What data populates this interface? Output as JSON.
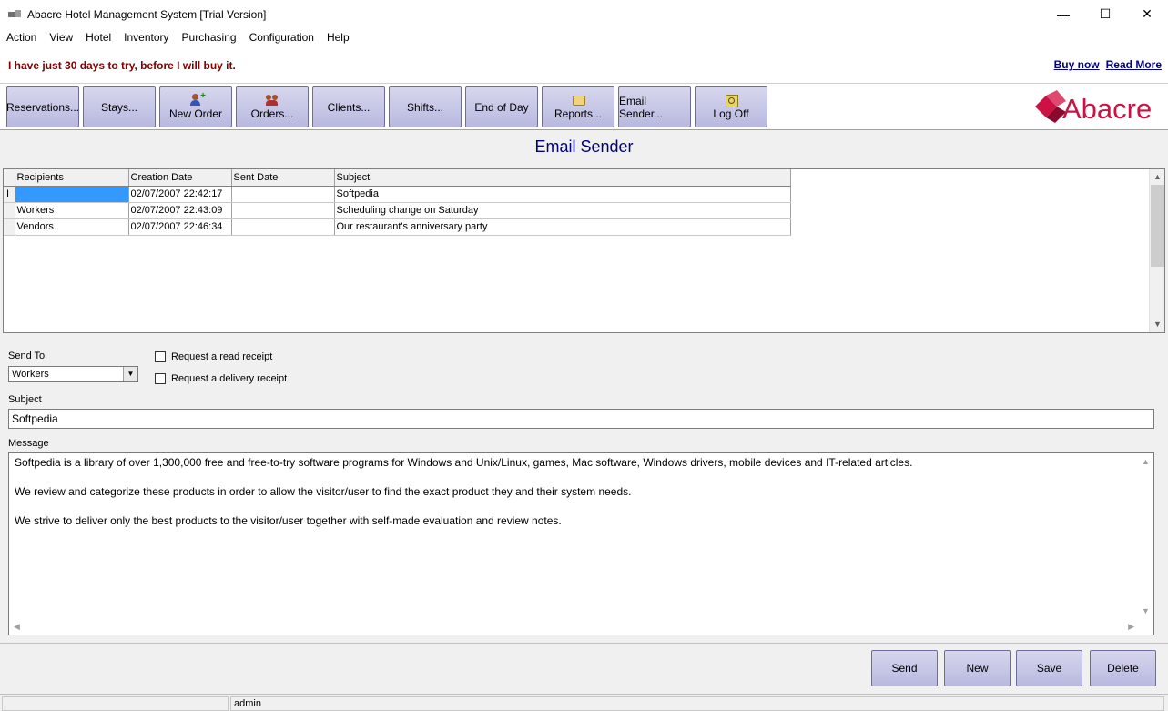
{
  "window": {
    "title": "Abacre Hotel Management System [Trial Version]",
    "controls": {
      "minimize": "—",
      "maximize": "☐",
      "close": "✕"
    }
  },
  "menu": [
    "Action",
    "View",
    "Hotel",
    "Inventory",
    "Purchasing",
    "Configuration",
    "Help"
  ],
  "banner": {
    "trial_text": "I have just 30 days to try, before I will buy it.",
    "buy_now": "Buy now",
    "read_more": "Read More"
  },
  "toolbar": {
    "buttons": [
      {
        "label": "Reservations...",
        "icon": ""
      },
      {
        "label": "Stays...",
        "icon": ""
      },
      {
        "label": "New Order",
        "icon": "new-order-icon"
      },
      {
        "label": "Orders...",
        "icon": "orders-icon"
      },
      {
        "label": "Clients...",
        "icon": ""
      },
      {
        "label": "Shifts...",
        "icon": ""
      },
      {
        "label": "End of Day",
        "icon": ""
      },
      {
        "label": "Reports...",
        "icon": "reports-icon"
      },
      {
        "label": "Email Sender...",
        "icon": ""
      },
      {
        "label": "Log Off",
        "icon": "log-off-icon"
      }
    ],
    "logo_text": "Abacre"
  },
  "page": {
    "title": "Email Sender"
  },
  "grid": {
    "columns": [
      "Recipients",
      "Creation Date",
      "Sent Date",
      "Subject"
    ],
    "rows": [
      {
        "recipients": "",
        "creation_date": "02/07/2007 22:42:17",
        "sent_date": "",
        "subject": "Softpedia"
      },
      {
        "recipients": "Workers",
        "creation_date": "02/07/2007 22:43:09",
        "sent_date": "",
        "subject": "Scheduling change on Saturday"
      },
      {
        "recipients": "Vendors",
        "creation_date": "02/07/2007 22:46:34",
        "sent_date": "",
        "subject": "Our restaurant's anniversary party"
      }
    ]
  },
  "form": {
    "send_to_label": "Send To",
    "send_to_value": "Workers",
    "read_receipt_label": "Request a read receipt",
    "delivery_receipt_label": "Request a delivery receipt",
    "subject_label": "Subject",
    "subject_value": "Softpedia",
    "message_label": "Message",
    "message_lines": [
      "Softpedia is a library of over 1,300,000 free and free-to-try software programs for Windows and Unix/Linux, games, Mac software, Windows drivers, mobile devices and IT-related articles.",
      "We review and categorize these products in order to allow the visitor/user to find the exact product they and their system needs.",
      "We strive to deliver only the best products to the visitor/user together with self-made evaluation and review notes."
    ]
  },
  "actions": {
    "send": "Send",
    "new": "New",
    "save": "Save",
    "delete": "Delete"
  },
  "status": {
    "user": "admin"
  },
  "colors": {
    "button_top": "#d6d6ee",
    "button_bottom": "#b9b9e0",
    "title_blue": "#000080",
    "trial_red": "#800000",
    "logo_red": "#cc1144",
    "selection": "#3399ff"
  }
}
